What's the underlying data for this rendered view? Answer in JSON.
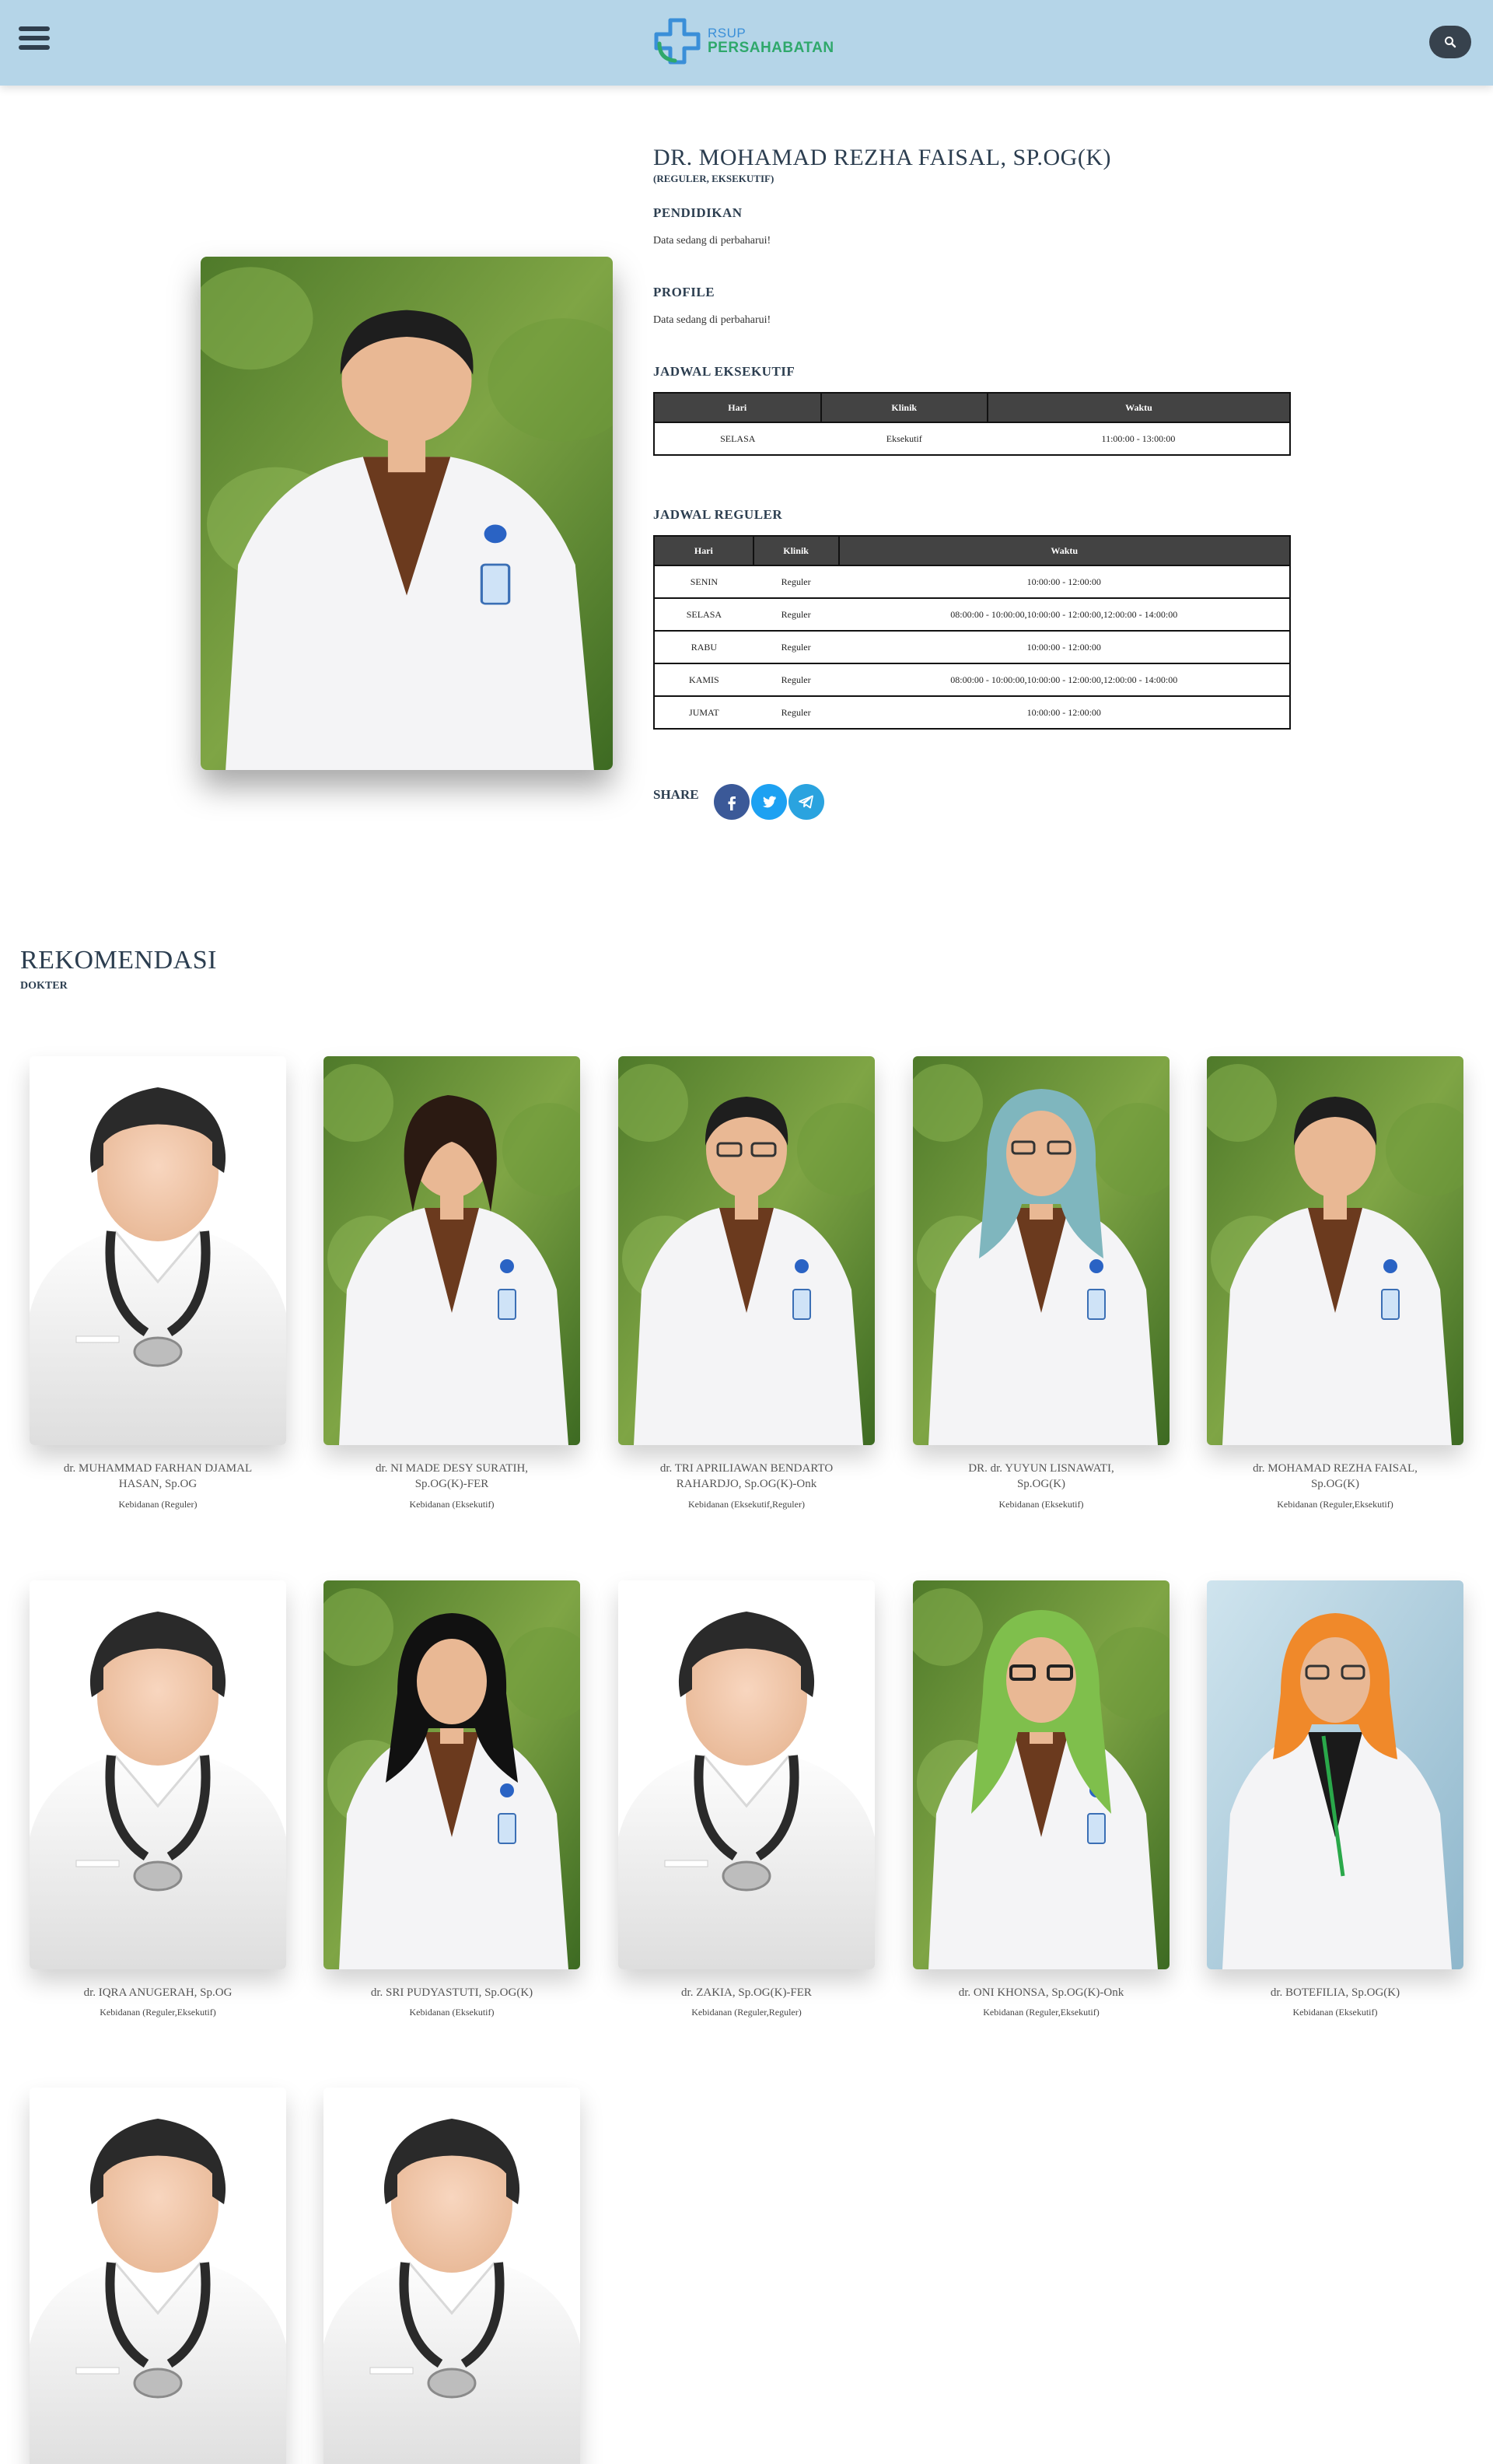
{
  "header": {
    "logo_line1": "RSUP",
    "logo_line2": "PERSAHABATAN"
  },
  "doctor": {
    "name": "DR. MOHAMAD REZHA FAISAL, SP.OG(K)",
    "type": "(REGULER, EKSEKUTIF)",
    "pendidikan_title": "PENDIDIKAN",
    "pendidikan_text": "Data sedang di perbaharui!",
    "profile_title": "PROFILE",
    "profile_text": "Data sedang di perbaharui!"
  },
  "jadwal_eksekutif": {
    "title": "JADWAL EKSEKUTIF",
    "headers": [
      "Hari",
      "Klinik",
      "Waktu"
    ],
    "rows": [
      [
        "SELASA",
        "Eksekutif",
        "11:00:00 - 13:00:00"
      ]
    ]
  },
  "jadwal_reguler": {
    "title": "JADWAL REGULER",
    "headers": [
      "Hari",
      "Klinik",
      "Waktu"
    ],
    "rows": [
      [
        "SENIN",
        "Reguler",
        "10:00:00 - 12:00:00"
      ],
      [
        "SELASA",
        "Reguler",
        "08:00:00 - 10:00:00,10:00:00 - 12:00:00,12:00:00 - 14:00:00"
      ],
      [
        "RABU",
        "Reguler",
        "10:00:00 - 12:00:00"
      ],
      [
        "KAMIS",
        "Reguler",
        "08:00:00 - 10:00:00,10:00:00 - 12:00:00,12:00:00 - 14:00:00"
      ],
      [
        "JUMAT",
        "Reguler",
        "10:00:00 - 12:00:00"
      ]
    ]
  },
  "share": {
    "label": "SHARE",
    "icons": [
      "facebook-icon",
      "twitter-icon",
      "telegram-icon"
    ]
  },
  "rekomendasi": {
    "title": "REKOMENDASI",
    "subtitle": "DOKTER",
    "cards": [
      {
        "name": "dr. MUHAMMAD FARHAN DJAMAL HASAN, Sp.OG",
        "poli": "Kebidanan (Reguler)"
      },
      {
        "name": "dr. NI MADE DESY SURATIH, Sp.OG(K)-FER",
        "poli": "Kebidanan (Eksekutif)"
      },
      {
        "name": "dr. TRI APRILIAWAN BENDARTO RAHARDJO, Sp.OG(K)-Onk",
        "poli": "Kebidanan (Eksekutif,Reguler)"
      },
      {
        "name": "DR. dr. YUYUN LISNAWATI, Sp.OG(K)",
        "poli": "Kebidanan (Eksekutif)"
      },
      {
        "name": "dr. MOHAMAD REZHA FAISAL, Sp.OG(K)",
        "poli": "Kebidanan (Reguler,Eksekutif)"
      },
      {
        "name": "dr. IQRA ANUGERAH, Sp.OG",
        "poli": "Kebidanan (Reguler,Eksekutif)"
      },
      {
        "name": "dr. SRI PUDYASTUTI, Sp.OG(K)",
        "poli": "Kebidanan (Eksekutif)"
      },
      {
        "name": "dr. ZAKIA, Sp.OG(K)-FER",
        "poli": "Kebidanan (Reguler,Reguler)"
      },
      {
        "name": "dr. ONI KHONSA, Sp.OG(K)-Onk",
        "poli": "Kebidanan (Reguler,Eksekutif)"
      },
      {
        "name": "dr. BOTEFILIA, Sp.OG(K)",
        "poli": "Kebidanan (Eksekutif)"
      }
    ]
  },
  "colors": {
    "header_bg": "#b5d5e8",
    "table_header_bg": "#434343",
    "facebook": "#3b5998",
    "twitter": "#1da1f2",
    "telegram": "#2aa3df"
  }
}
